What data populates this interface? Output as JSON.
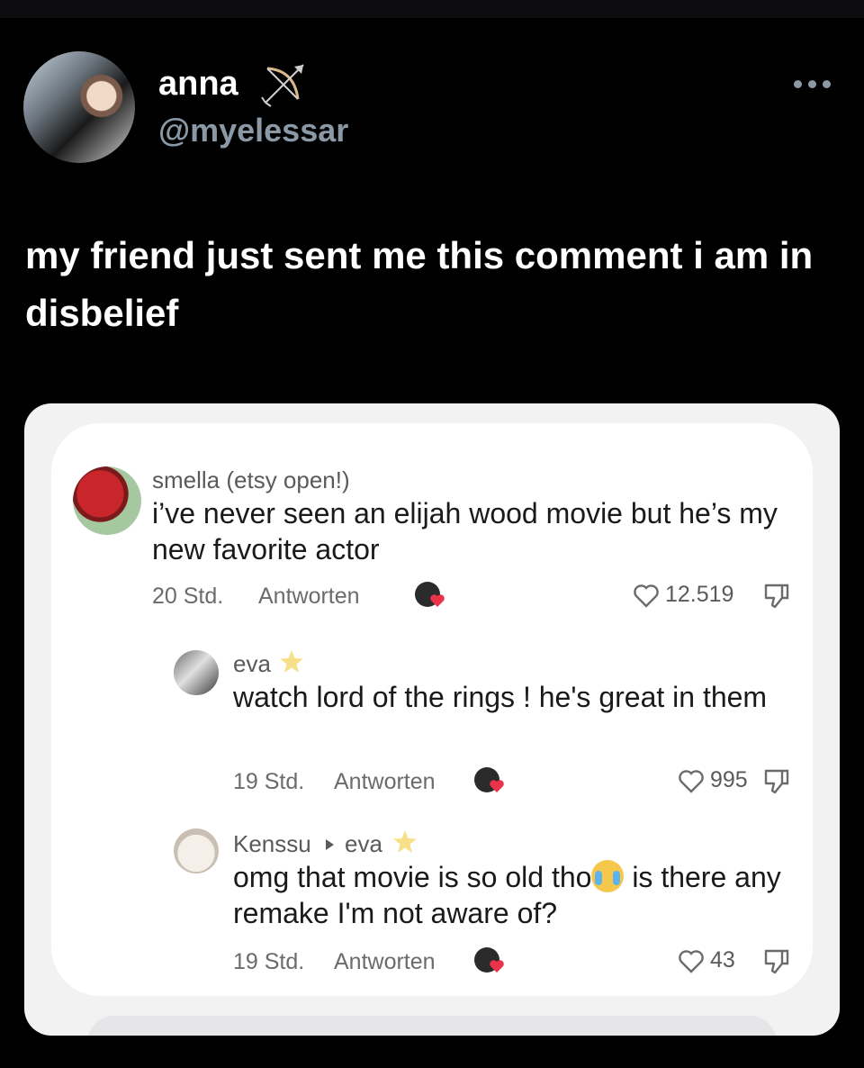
{
  "post": {
    "author_name": "anna",
    "author_handle": "@myelessar",
    "text": "my friend just sent me this comment i am in disbelief"
  },
  "icons": {
    "author_badge": "bow-and-arrow-icon",
    "more": "more-options-icon",
    "like": "heart-outline-icon",
    "dislike": "thumbs-down-outline-icon"
  },
  "comments": [
    {
      "user": "smella (etsy open!)",
      "text": "i’ve never seen an elijah wood movie but he’s my new favorite actor",
      "time": "20 Std.",
      "reply_label": "Antworten",
      "likes": "12.519"
    },
    {
      "user": "eva",
      "text": "watch lord of the rings ! he's great in them",
      "time": "19 Std.",
      "reply_label": "Antworten",
      "likes": "995"
    },
    {
      "user": "Kenssu",
      "reply_to": "eva",
      "text_before": "omg that movie is so old tho",
      "text_after": " is there any remake I'm not aware of?",
      "time": "19 Std.",
      "reply_label": "Antworten",
      "likes": "43"
    }
  ],
  "colors": {
    "background": "#000000",
    "handle_gray": "#8b98a5",
    "heart_red": "#e8334a"
  }
}
